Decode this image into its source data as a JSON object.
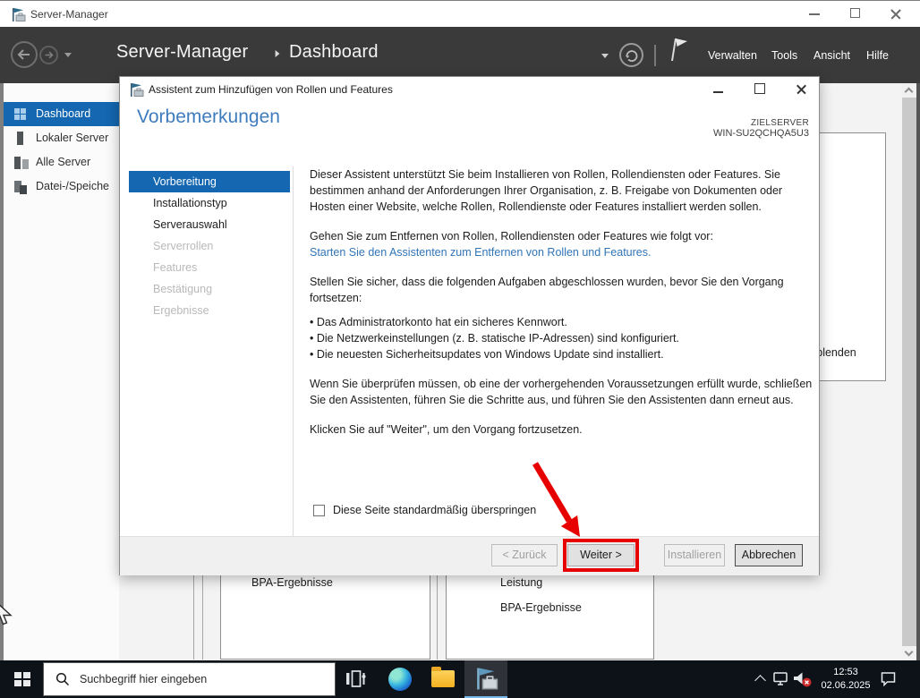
{
  "window": {
    "title": "Server-Manager"
  },
  "header": {
    "breadcrumb_root": "Server-Manager",
    "breadcrumb_current": "Dashboard",
    "menus": {
      "manage": "Verwalten",
      "tools": "Tools",
      "view": "Ansicht",
      "help": "Hilfe"
    }
  },
  "sidebar": {
    "items": [
      {
        "label": "Dashboard",
        "active": true
      },
      {
        "label": "Lokaler Server",
        "active": false
      },
      {
        "label": "Alle Server",
        "active": false
      },
      {
        "label": "Datei-/Speiche",
        "active": false
      }
    ]
  },
  "dashboard": {
    "tile_left_label": "BPA-Ergebnisse",
    "tile_right_label_1": "Leistung",
    "tile_right_label_2": "BPA-Ergebnisse",
    "hide_link_fragment": "sblenden"
  },
  "wizard": {
    "title": "Assistent zum Hinzufügen von Rollen und Features",
    "heading": "Vorbemerkungen",
    "target_label": "ZIELSERVER",
    "target_server": "WIN-SU2QCHQA5U3",
    "steps": [
      {
        "label": "Vorbereitung",
        "state": "active"
      },
      {
        "label": "Installationstyp",
        "state": "enabled"
      },
      {
        "label": "Serverauswahl",
        "state": "enabled"
      },
      {
        "label": "Serverrollen",
        "state": "disabled"
      },
      {
        "label": "Features",
        "state": "disabled"
      },
      {
        "label": "Bestätigung",
        "state": "disabled"
      },
      {
        "label": "Ergebnisse",
        "state": "disabled"
      }
    ],
    "intro": "Dieser Assistent unterstützt Sie beim Installieren von Rollen, Rollendiensten oder Features. Sie bestimmen anhand der Anforderungen Ihrer Organisation, z. B. Freigabe von Dokumenten oder Hosten einer Website, welche Rollen, Rollendienste oder Features installiert werden sollen.",
    "remove_intro": "Gehen Sie zum Entfernen von Rollen, Rollendiensten oder Features wie folgt vor:",
    "remove_link": "Starten Sie den Assistenten zum Entfernen von Rollen und Features.",
    "tasks_intro": "Stellen Sie sicher, dass die folgenden Aufgaben abgeschlossen wurden, bevor Sie den Vorgang fortsetzen:",
    "tasks": [
      "Das Administratorkonto hat ein sicheres Kennwort.",
      "Die Netzwerkeinstellungen (z. B. statische IP-Adressen) sind konfiguriert.",
      "Die neuesten Sicherheitsupdates von Windows Update sind installiert."
    ],
    "verify_note": "Wenn Sie überprüfen müssen, ob eine der vorhergehenden Voraussetzungen erfüllt wurde, schließen Sie den Assistenten, führen Sie die Schritte aus, und führen Sie den Assistenten dann erneut aus.",
    "continue_note": "Klicken Sie auf \"Weiter\", um den Vorgang fortzusetzen.",
    "skip_checkbox_label": "Diese Seite standardmäßig überspringen",
    "buttons": {
      "back": "< Zurück",
      "next": "Weiter >",
      "install": "Installieren",
      "cancel": "Abbrechen"
    }
  },
  "taskbar": {
    "search_placeholder": "Suchbegriff hier eingeben",
    "time": "12:53",
    "date": "02.06.2025"
  },
  "colors": {
    "accent_blue": "#1467b0",
    "heading_blue": "#3e7cbe",
    "link_blue": "#3175b7",
    "annotation_red": "#e60000",
    "header_gray": "#3a3a3a",
    "taskbar_dark": "#0d1219"
  }
}
